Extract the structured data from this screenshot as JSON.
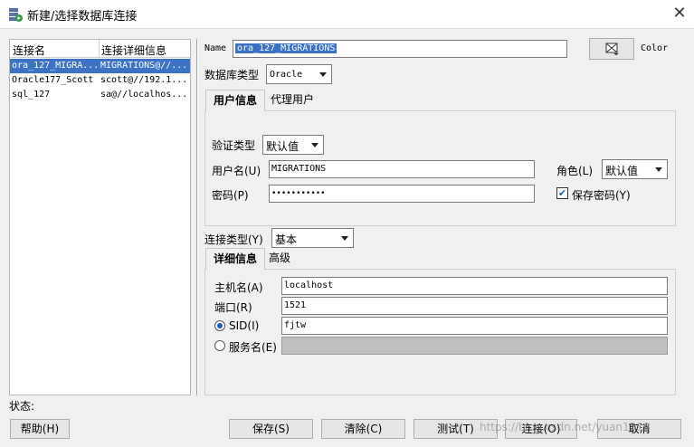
{
  "window": {
    "title": "新建/选择数据库连接"
  },
  "connections": {
    "headers": [
      "连接名",
      "连接详细信息"
    ],
    "rows": [
      {
        "name": "ora_127_MIGRA...",
        "details": "MIGRATIONS@//..."
      },
      {
        "name": "Oracle177_Scott",
        "details": "scott@//192.1..."
      },
      {
        "name": "sql_127",
        "details": "sa@//localhos..."
      }
    ]
  },
  "form": {
    "name_label": "Name",
    "name_value": "ora_127_MIGRATIONS",
    "color_label": "Color",
    "db_type_label": "数据库类型",
    "db_type_value": "Oracle",
    "user_tabs": [
      "用户信息",
      "代理用户"
    ],
    "auth_type_label": "验证类型",
    "auth_type_value": "默认值",
    "username_label": "用户名(U)",
    "username_value": "MIGRATIONS",
    "role_label": "角色(L)",
    "role_value": "默认值",
    "password_label": "密码(P)",
    "password_value": "•••••••••••",
    "save_password_label": "保存密码(Y)",
    "save_password_checked": true,
    "conn_type_label": "连接类型(Y)",
    "conn_type_value": "基本",
    "detail_tabs": [
      "详细信息",
      "高级"
    ],
    "host_label": "主机名(A)",
    "host_value": "localhost",
    "port_label": "端口(R)",
    "port_value": "1521",
    "sid_label": "SID(I)",
    "sid_value": "fjtw",
    "sid_selected": true,
    "service_label": "服务名(E)",
    "service_value": ""
  },
  "status": {
    "label": "状态:"
  },
  "buttons": {
    "help": "帮助(H)",
    "save": "保存(S)",
    "clear": "清除(C)",
    "test": "测试(T)",
    "connect": "连接(O)",
    "cancel": "取消"
  },
  "watermark": "https://blog.csdn.net/yuan1318"
}
